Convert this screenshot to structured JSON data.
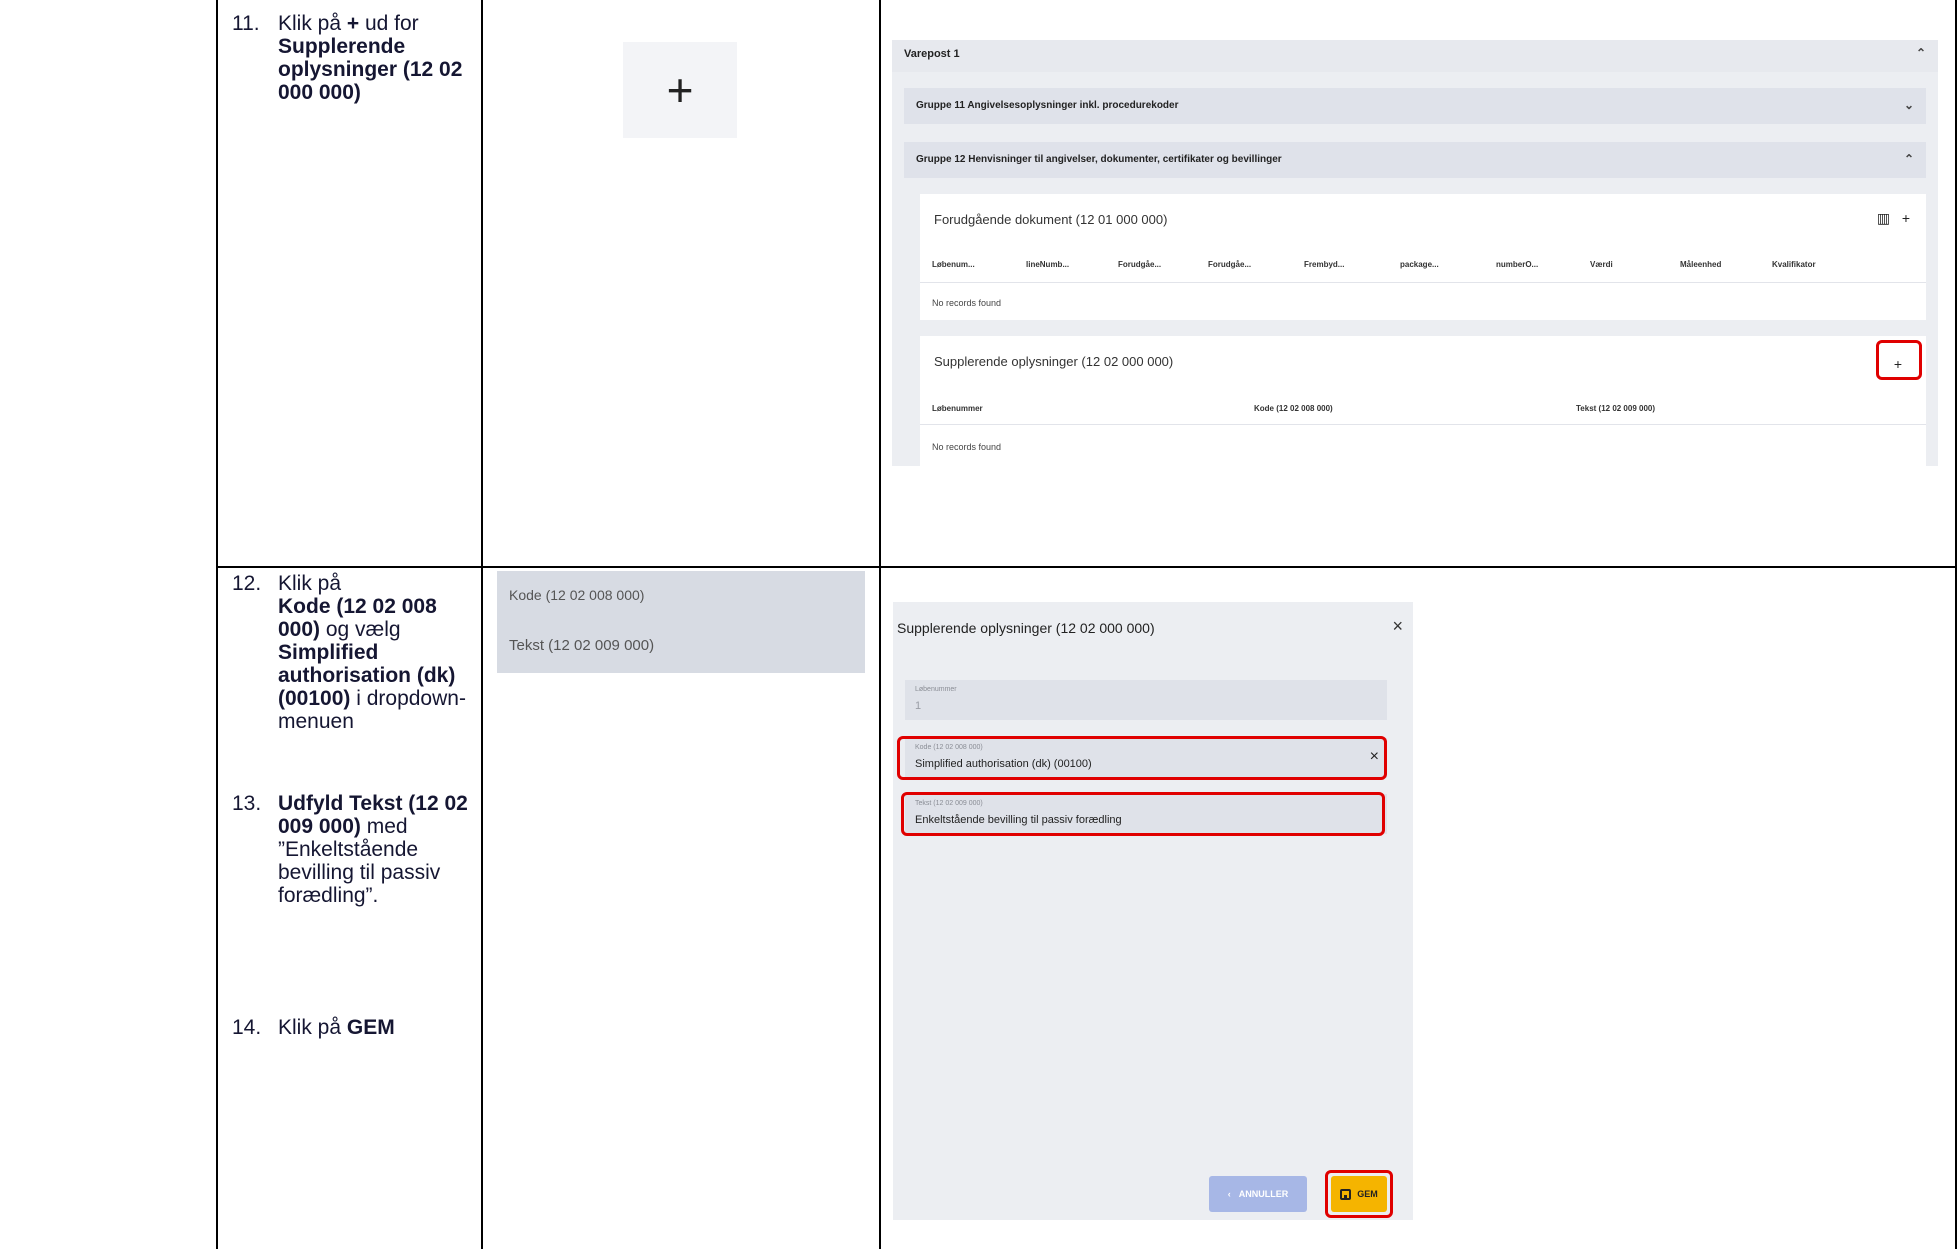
{
  "steps": {
    "s11": {
      "num": "11.",
      "pre": "Klik på ",
      "plus": "+",
      "mid": " ud for",
      "bold": "Supplerende oplysninger (12 02 000 000)"
    },
    "s12": {
      "num": "12.",
      "pre": "Klik på ",
      "b1": "Kode (12 02 008 000)",
      "mid": " og vælg ",
      "b2": "Simplified authorisation (dk) (00100)",
      "post": " i dropdown-menuen"
    },
    "s13": {
      "num": "13.",
      "b1": "Udfyld Tekst (12 02 009 000)",
      "post": " med ”Enkeltstående bevilling til passiv forædling”."
    },
    "s14": {
      "num": "14.",
      "pre": "Klik på ",
      "b1": "GEM"
    }
  },
  "plus_tile": {
    "glyph": "+"
  },
  "shot1": {
    "varepost": "Varepost 1",
    "gruppe11": "Gruppe 11 Angivelsesoplysninger inkl. procedurekoder",
    "gruppe12": "Gruppe 12 Henvisninger til angivelser, dokumenter, certifikater og bevillinger",
    "panel1": {
      "title": "Forudgående dokument (12 01 000 000)",
      "columns": [
        "Løbenum...",
        "lineNumb...",
        "Forudgåe...",
        "Forudgåe...",
        "Frembyd...",
        "package...",
        "numberO...",
        "Værdi",
        "Måleenhed",
        "Kvalifikator"
      ],
      "empty": "No records found"
    },
    "panel2": {
      "title": "Supplerende oplysninger (12 02 000 000)",
      "columns": [
        "Løbenummer",
        "Kode (12 02 008 000)",
        "Tekst (12 02 009 000)"
      ],
      "empty": "No records found"
    },
    "icons": {
      "caret_up": "⌃",
      "caret_down": "⌄",
      "columns": "▥",
      "add": "+"
    }
  },
  "dropdown": {
    "item1": "Kode (12 02 008 000)",
    "item2": "Tekst (12 02 009 000)"
  },
  "shot2": {
    "title": "Supplerende oplysninger (12 02 000 000)",
    "close": "×",
    "lobenummer": {
      "label": "Løbenummer",
      "value": "1"
    },
    "kode": {
      "label": "Kode (12 02 008 000)",
      "value": "Simplified authorisation (dk) (00100)",
      "clear": "×"
    },
    "tekst": {
      "label": "Tekst (12 02 009 000)",
      "value": "Enkeltstående bevilling til passiv forædling"
    },
    "cancel": "ANNULLER",
    "cancel_icon": "‹",
    "save": "GEM"
  },
  "colors": {
    "highlight": "#e00000",
    "save": "#f5b400",
    "cancel": "#a7b7e6"
  }
}
